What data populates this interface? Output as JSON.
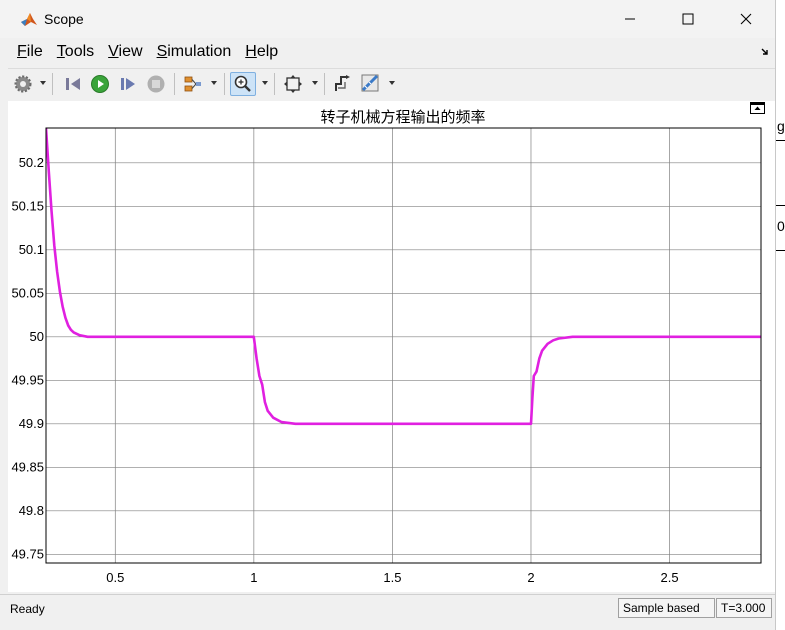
{
  "window": {
    "title": "Scope",
    "controls": [
      "minimize",
      "maximize",
      "close"
    ]
  },
  "menu": [
    "File",
    "Tools",
    "View",
    "Simulation",
    "Help"
  ],
  "menu_mnemonics": [
    "F",
    "T",
    "V",
    "S",
    "H"
  ],
  "toolbar": {
    "icons": [
      "gear-icon",
      "step-back-icon",
      "run-icon",
      "step-forward-icon",
      "stop-icon",
      "signal-selector-icon",
      "zoom-icon",
      "fit-axes-icon",
      "triggers-icon",
      "measurements-icon"
    ]
  },
  "status": {
    "ready": "Ready",
    "sample_mode": "Sample based",
    "time": "T=3.000"
  },
  "background_text": {
    "right_top": "g",
    "right_mid": "0"
  },
  "colors": {
    "trace": "#e020e0",
    "grid": "#808080",
    "plot_bg": "#ffffff",
    "active_tool": "#cde3f7"
  },
  "chart_data": {
    "type": "line",
    "title": "转子机械方程输出的频率",
    "xlabel": "",
    "ylabel": "",
    "xlim": [
      0.25,
      2.83
    ],
    "ylim": [
      49.74,
      50.24
    ],
    "xticks": [
      0.5,
      1,
      1.5,
      2,
      2.5
    ],
    "xtick_labels": [
      "0.5",
      "1",
      "1.5",
      "2",
      "2.5"
    ],
    "yticks": [
      49.75,
      49.8,
      49.85,
      49.9,
      49.95,
      50,
      50.05,
      50.1,
      50.15,
      50.2
    ],
    "ytick_labels": [
      "49.75",
      "49.8",
      "49.85",
      "49.9",
      "49.95",
      "50",
      "50.05",
      "50.1",
      "50.15",
      "50.2"
    ],
    "grid": true,
    "series": [
      {
        "x": [
          0.25,
          0.26,
          0.27,
          0.28,
          0.29,
          0.3,
          0.31,
          0.32,
          0.33,
          0.34,
          0.35,
          0.37,
          0.4,
          0.45,
          0.5,
          0.7,
          0.9,
          1.0,
          1.01,
          1.02,
          1.03,
          1.04,
          1.05,
          1.07,
          1.1,
          1.15,
          1.2,
          1.5,
          1.8,
          2.0,
          2.005,
          2.01,
          2.02,
          2.03,
          2.04,
          2.06,
          2.08,
          2.1,
          2.15,
          2.2,
          2.5,
          2.83
        ],
        "y": [
          50.24,
          50.19,
          50.145,
          50.105,
          50.075,
          50.052,
          50.035,
          50.022,
          50.013,
          50.008,
          50.005,
          50.002,
          50.0,
          50.0,
          50.0,
          50.0,
          50.0,
          50.0,
          49.975,
          49.955,
          49.945,
          49.925,
          49.915,
          49.907,
          49.902,
          49.9,
          49.9,
          49.9,
          49.9,
          49.9,
          49.93,
          49.955,
          49.96,
          49.975,
          49.984,
          49.992,
          49.996,
          49.998,
          50.0,
          50.0,
          50.0,
          50.0
        ]
      }
    ]
  }
}
